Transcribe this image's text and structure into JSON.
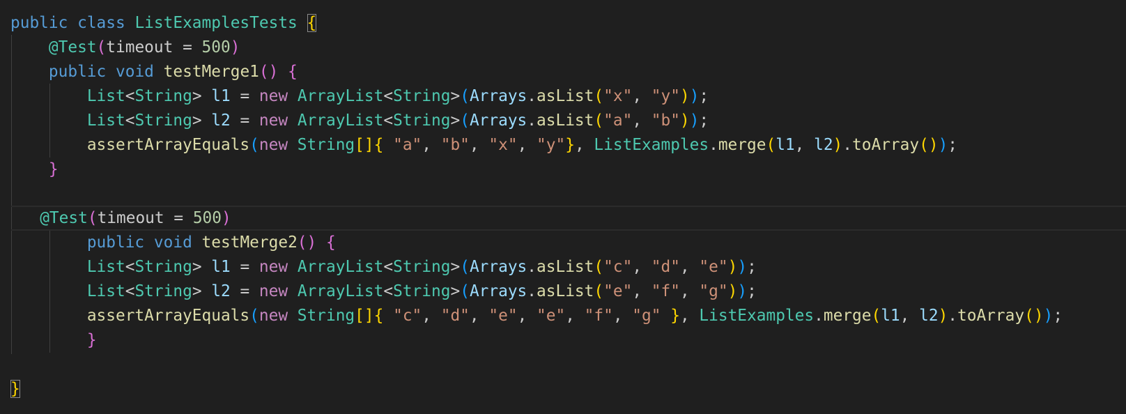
{
  "editor": {
    "language": "java",
    "theme": {
      "background": "#1f1f1f",
      "keyword": "#569cd6",
      "control": "#c586c0",
      "type": "#4ec9b0",
      "function": "#dcdcaa",
      "variable": "#9cdcfe",
      "string": "#ce9178",
      "number": "#b5cea8",
      "bracket_levels": [
        "#ffd700",
        "#da70d6",
        "#179fff"
      ]
    },
    "lines": [
      "public class ListExamplesTests {",
      "    @Test(timeout = 500)",
      "    public void testMerge1() {",
      "        List<String> l1 = new ArrayList<String>(Arrays.asList(\"x\", \"y\"));",
      "        List<String> l2 = new ArrayList<String>(Arrays.asList(\"a\", \"b\"));",
      "        assertArrayEquals(new String[]{ \"a\", \"b\", \"x\", \"y\"}, ListExamples.merge(l1, l2).toArray());",
      "    }",
      "",
      "    @Test(timeout = 500)",
      "        public void testMerge2() {",
      "        List<String> l1 = new ArrayList<String>(Arrays.asList(\"c\", \"d\", \"e\"));",
      "        List<String> l2 = new ArrayList<String>(Arrays.asList(\"e\", \"f\", \"g\"));",
      "        assertArrayEquals(new String[]{ \"c\", \"d\", \"e\", \"e\", \"f\", \"g\" }, ListExamples.merge(l1, l2).toArray());",
      "        }",
      "",
      "}"
    ],
    "tokens": {
      "kw_public": "public",
      "kw_class": "class",
      "kw_void": "void",
      "kw_new": "new",
      "class_name": "ListExamplesTests",
      "annotation_at": "@",
      "annotation": "Test",
      "timeout": "timeout",
      "eq": " = ",
      "num_500": "500",
      "method1": "testMerge1",
      "method2": "testMerge2",
      "type_list": "List",
      "type_string": "String",
      "type_arraylist": "ArrayList",
      "arrays": "Arrays",
      "aslist": "asList",
      "l1": "l1",
      "l2": "l2",
      "assert": "assertArrayEquals",
      "listexamples": "ListExamples",
      "merge": "merge",
      "toarray": "toArray",
      "s_x": "\"x\"",
      "s_y": "\"y\"",
      "s_a": "\"a\"",
      "s_b": "\"b\"",
      "s_c": "\"c\"",
      "s_d": "\"d\"",
      "s_e": "\"e\"",
      "s_f": "\"f\"",
      "s_g": "\"g\"",
      "lt": "<",
      "gt": ">",
      "dot": ".",
      "comma": ", ",
      "semi": ";",
      "lp": "(",
      "rp": ")",
      "lb": "{",
      "rb": "}",
      "lsq": "[",
      "rsq": "]",
      "sp": " ",
      "assign": " = "
    }
  }
}
